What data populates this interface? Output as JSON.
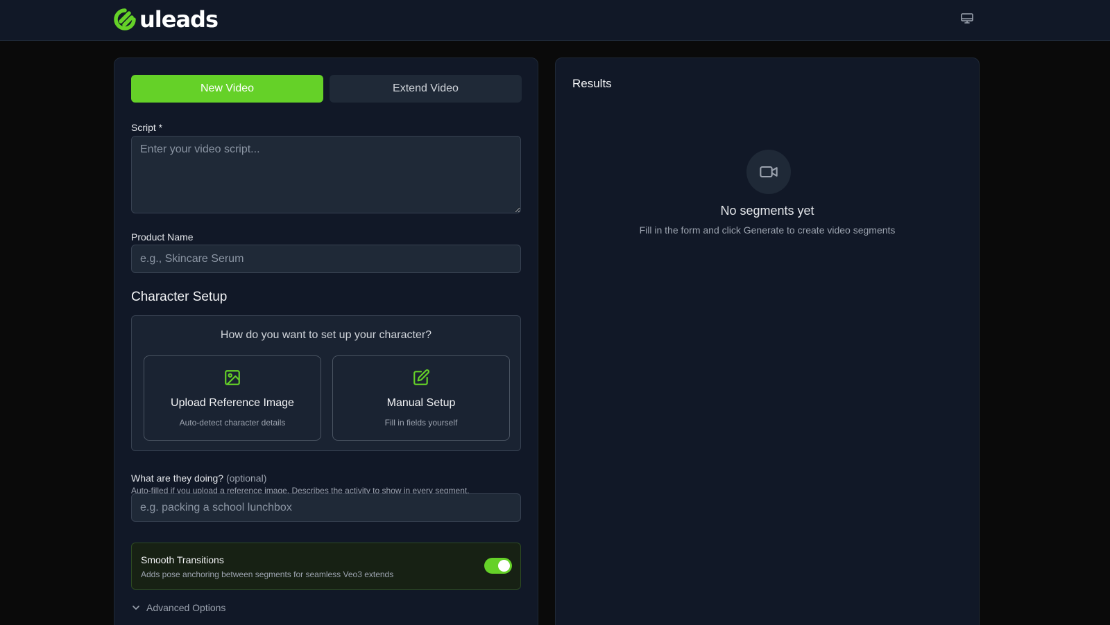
{
  "header": {
    "brand": "uleads",
    "logo_icon": "uleads-logo-icon",
    "monitor_icon": "monitor-icon"
  },
  "tabs": {
    "new_video": "New Video",
    "extend_video": "Extend Video"
  },
  "form": {
    "script": {
      "label": "Script *",
      "placeholder": "Enter your video script...",
      "value": ""
    },
    "product_name": {
      "label": "Product Name",
      "placeholder": "e.g., Skincare Serum",
      "value": ""
    },
    "character_setup": {
      "title": "Character Setup",
      "question": "How do you want to set up your character?",
      "upload": {
        "title": "Upload Reference Image",
        "subtitle": "Auto-detect character details",
        "icon": "image-icon"
      },
      "manual": {
        "title": "Manual Setup",
        "subtitle": "Fill in fields yourself",
        "icon": "edit-icon"
      }
    },
    "activity": {
      "label": "What are they doing?",
      "optional": "(optional)",
      "help": "Auto-filled if you upload a reference image. Describes the activity to show in every segment.",
      "placeholder": "e.g. packing a school lunchbox",
      "value": ""
    },
    "smooth_transitions": {
      "title": "Smooth Transitions",
      "subtitle": "Adds pose anchoring between segments for seamless Veo3 extends",
      "enabled": true
    },
    "advanced_options": "Advanced Options"
  },
  "results": {
    "title": "Results",
    "empty_title": "No segments yet",
    "empty_subtitle": "Fill in the form and click Generate to create video segments",
    "empty_icon": "video-camera-icon"
  },
  "colors": {
    "accent": "#65d128",
    "background": "#0a0a0a",
    "panel": "#111827",
    "input": "#1f2937"
  }
}
